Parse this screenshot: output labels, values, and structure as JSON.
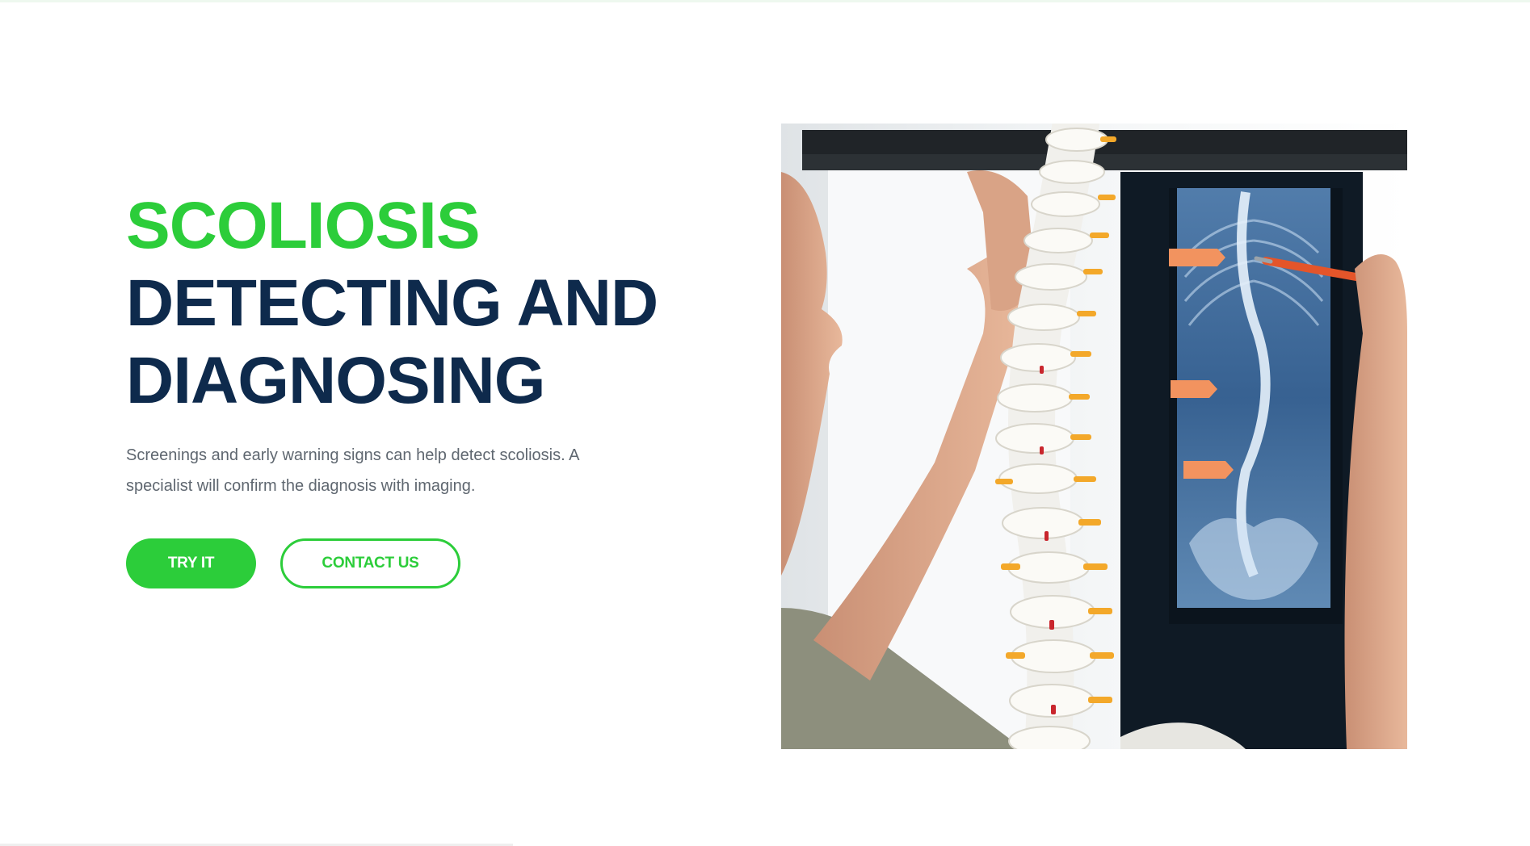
{
  "hero": {
    "title_accent": "SCOLIOSIS",
    "title_line_1": "DETECTING AND",
    "title_line_2": "DIAGNOSING",
    "description": "Screenings and early warning signs can help detect scoliosis. A specialist will confirm the diagnosis with imaging.",
    "primary_button": "TRY IT",
    "secondary_button": "CONTACT US"
  },
  "colors": {
    "accent": "#2ccd3a",
    "heading": "#0e2a4c",
    "body_text": "#5f6770"
  }
}
